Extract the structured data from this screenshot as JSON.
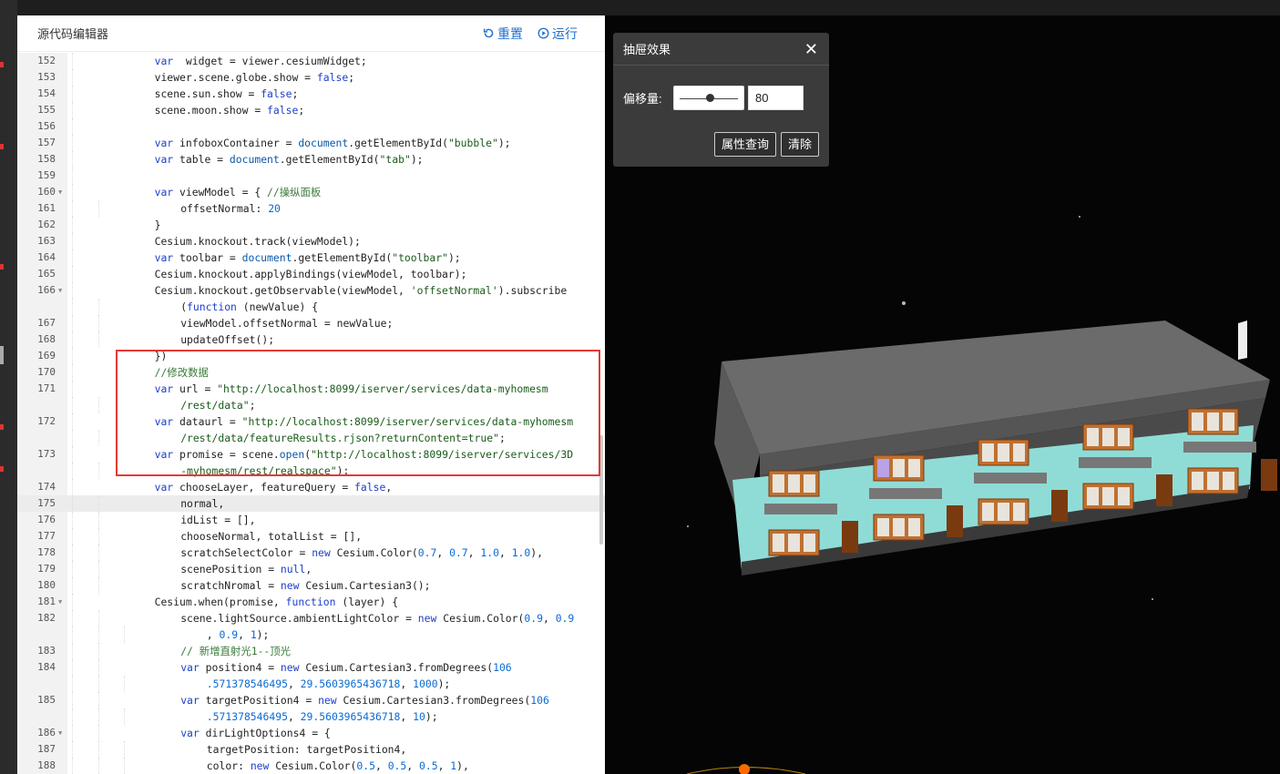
{
  "editor": {
    "title": "源代码编辑器",
    "reset_label": "重置",
    "run_label": "运行"
  },
  "code_lines": [
    {
      "n": "152",
      "i": 1,
      "t": [
        [
          "kw",
          "var"
        ],
        [
          "",
          "  widget = viewer.cesiumWidget;"
        ]
      ]
    },
    {
      "n": "153",
      "i": 1,
      "t": [
        [
          "",
          "viewer.scene.globe.show = "
        ],
        [
          "kw",
          "false"
        ],
        [
          "",
          ";"
        ]
      ]
    },
    {
      "n": "154",
      "i": 1,
      "t": [
        [
          "",
          "scene.sun.show = "
        ],
        [
          "kw",
          "false"
        ],
        [
          "",
          ";"
        ]
      ]
    },
    {
      "n": "155",
      "i": 1,
      "t": [
        [
          "",
          "scene.moon.show = "
        ],
        [
          "kw",
          "false"
        ],
        [
          "",
          ";"
        ]
      ]
    },
    {
      "n": "156",
      "i": 1,
      "t": []
    },
    {
      "n": "157",
      "i": 1,
      "t": [
        [
          "kw",
          "var"
        ],
        [
          "",
          " infoboxContainer = "
        ],
        [
          "prop",
          "document"
        ],
        [
          "",
          ".getElementById("
        ],
        [
          "str2",
          "\"bubble\""
        ],
        [
          "",
          ");"
        ]
      ]
    },
    {
      "n": "158",
      "i": 1,
      "t": [
        [
          "kw",
          "var"
        ],
        [
          "",
          " table = "
        ],
        [
          "prop",
          "document"
        ],
        [
          "",
          ".getElementById("
        ],
        [
          "str2",
          "\"tab\""
        ],
        [
          "",
          ");"
        ]
      ]
    },
    {
      "n": "159",
      "i": 1,
      "t": []
    },
    {
      "n": "160",
      "i": 1,
      "f": true,
      "t": [
        [
          "kw",
          "var"
        ],
        [
          "",
          " viewModel = { "
        ],
        [
          "cm",
          "//操纵面板"
        ]
      ]
    },
    {
      "n": "161",
      "i": 2,
      "t": [
        [
          "",
          "offsetNormal: "
        ],
        [
          "num",
          "20"
        ]
      ]
    },
    {
      "n": "162",
      "i": 1,
      "t": [
        [
          "",
          "}"
        ]
      ]
    },
    {
      "n": "163",
      "i": 1,
      "t": [
        [
          "",
          "Cesium.knockout.track(viewModel);"
        ]
      ]
    },
    {
      "n": "164",
      "i": 1,
      "t": [
        [
          "kw",
          "var"
        ],
        [
          "",
          " toolbar = "
        ],
        [
          "prop",
          "document"
        ],
        [
          "",
          ".getElementById("
        ],
        [
          "str2",
          "\"toolbar\""
        ],
        [
          "",
          ");"
        ]
      ]
    },
    {
      "n": "165",
      "i": 1,
      "t": [
        [
          "",
          "Cesium.knockout.applyBindings(viewModel, toolbar);"
        ]
      ]
    },
    {
      "n": "166",
      "i": 1,
      "f": true,
      "t": [
        [
          "",
          "Cesium.knockout.getObservable(viewModel, "
        ],
        [
          "str2",
          "'offsetNormal'"
        ],
        [
          "",
          ").subscribe"
        ]
      ]
    },
    {
      "n": "",
      "i": 2,
      "t": [
        [
          "",
          "("
        ],
        [
          "kw",
          "function"
        ],
        [
          "",
          " (newValue) {"
        ]
      ]
    },
    {
      "n": "167",
      "i": 2,
      "t": [
        [
          "",
          "viewModel.offsetNormal = newValue;"
        ]
      ]
    },
    {
      "n": "168",
      "i": 2,
      "t": [
        [
          "",
          "updateOffset();"
        ]
      ]
    },
    {
      "n": "169",
      "i": 1,
      "t": [
        [
          "",
          "})"
        ]
      ]
    },
    {
      "n": "170",
      "i": 1,
      "t": [
        [
          "cm",
          "//修改数据"
        ]
      ]
    },
    {
      "n": "171",
      "i": 1,
      "t": [
        [
          "kw",
          "var"
        ],
        [
          "",
          " url = "
        ],
        [
          "str2",
          "\"http://localhost:8099/iserver/services/data-myhomesm"
        ]
      ]
    },
    {
      "n": "",
      "i": 2,
      "t": [
        [
          "str2",
          "/rest/data\""
        ],
        [
          "",
          ";"
        ]
      ]
    },
    {
      "n": "172",
      "i": 1,
      "t": [
        [
          "kw",
          "var"
        ],
        [
          "",
          " dataurl = "
        ],
        [
          "str2",
          "\"http://localhost:8099/iserver/services/data-myhomesm"
        ]
      ]
    },
    {
      "n": "",
      "i": 2,
      "t": [
        [
          "str2",
          "/rest/data/featureResults.rjson?returnContent=true\""
        ],
        [
          "",
          ";"
        ]
      ]
    },
    {
      "n": "173",
      "i": 1,
      "t": [
        [
          "kw",
          "var"
        ],
        [
          "",
          " promise = scene."
        ],
        [
          "prop",
          "open"
        ],
        [
          "",
          "("
        ],
        [
          "str2",
          "\"http://localhost:8099/iserver/services/3D"
        ]
      ]
    },
    {
      "n": "",
      "i": 2,
      "t": [
        [
          "str2",
          "-myhomesm/rest/realspace\""
        ],
        [
          "",
          ");"
        ]
      ]
    },
    {
      "n": "174",
      "i": 1,
      "t": [
        [
          "kw",
          "var"
        ],
        [
          "",
          " chooseLayer, featureQuery = "
        ],
        [
          "kw",
          "false"
        ],
        [
          "",
          ","
        ]
      ]
    },
    {
      "n": "175",
      "i": 2,
      "a": true,
      "t": [
        [
          "",
          "normal,"
        ]
      ]
    },
    {
      "n": "176",
      "i": 2,
      "t": [
        [
          "",
          "idList = [],"
        ]
      ]
    },
    {
      "n": "177",
      "i": 2,
      "t": [
        [
          "",
          "chooseNormal, totalList = [],"
        ]
      ]
    },
    {
      "n": "178",
      "i": 2,
      "t": [
        [
          "",
          "scratchSelectColor = "
        ],
        [
          "kw",
          "new"
        ],
        [
          "",
          " Cesium.Color("
        ],
        [
          "num",
          "0.7"
        ],
        [
          "",
          ", "
        ],
        [
          "num",
          "0.7"
        ],
        [
          "",
          ", "
        ],
        [
          "num",
          "1.0"
        ],
        [
          "",
          ", "
        ],
        [
          "num",
          "1.0"
        ],
        [
          "",
          "),"
        ]
      ]
    },
    {
      "n": "179",
      "i": 2,
      "t": [
        [
          "",
          "scenePosition = "
        ],
        [
          "kw",
          "null"
        ],
        [
          "",
          ","
        ]
      ]
    },
    {
      "n": "180",
      "i": 2,
      "t": [
        [
          "",
          "scratchNromal = "
        ],
        [
          "kw",
          "new"
        ],
        [
          "",
          " Cesium.Cartesian3();"
        ]
      ]
    },
    {
      "n": "181",
      "i": 1,
      "f": true,
      "t": [
        [
          "",
          "Cesium.when(promise, "
        ],
        [
          "kw",
          "function"
        ],
        [
          "",
          " (layer) {"
        ]
      ]
    },
    {
      "n": "182",
      "i": 2,
      "t": [
        [
          "",
          "scene.lightSource.ambientLightColor = "
        ],
        [
          "kw",
          "new"
        ],
        [
          "",
          " Cesium.Color("
        ],
        [
          "num",
          "0.9"
        ],
        [
          "",
          ", "
        ],
        [
          "num",
          "0.9"
        ]
      ]
    },
    {
      "n": "",
      "i": 3,
      "t": [
        [
          "",
          ", "
        ],
        [
          "num",
          "0.9"
        ],
        [
          "",
          ", "
        ],
        [
          "num",
          "1"
        ],
        [
          "",
          ");"
        ]
      ]
    },
    {
      "n": "183",
      "i": 2,
      "t": [
        [
          "cm",
          "// 新增直射光1--顶光"
        ]
      ]
    },
    {
      "n": "184",
      "i": 2,
      "t": [
        [
          "kw",
          "var"
        ],
        [
          "",
          " position4 = "
        ],
        [
          "kw",
          "new"
        ],
        [
          "",
          " Cesium.Cartesian3.fromDegrees("
        ],
        [
          "num",
          "106"
        ]
      ]
    },
    {
      "n": "",
      "i": 3,
      "t": [
        [
          "num",
          ".571378546495"
        ],
        [
          "",
          ", "
        ],
        [
          "num",
          "29.5603965436718"
        ],
        [
          "",
          ", "
        ],
        [
          "num",
          "1000"
        ],
        [
          "",
          ");"
        ]
      ]
    },
    {
      "n": "185",
      "i": 2,
      "t": [
        [
          "kw",
          "var"
        ],
        [
          "",
          " targetPosition4 = "
        ],
        [
          "kw",
          "new"
        ],
        [
          "",
          " Cesium.Cartesian3.fromDegrees("
        ],
        [
          "num",
          "106"
        ]
      ]
    },
    {
      "n": "",
      "i": 3,
      "t": [
        [
          "num",
          ".571378546495"
        ],
        [
          "",
          ", "
        ],
        [
          "num",
          "29.5603965436718"
        ],
        [
          "",
          ", "
        ],
        [
          "num",
          "10"
        ],
        [
          "",
          ");"
        ]
      ]
    },
    {
      "n": "186",
      "i": 2,
      "f": true,
      "t": [
        [
          "kw",
          "var"
        ],
        [
          "",
          " dirLightOptions4 = {"
        ]
      ]
    },
    {
      "n": "187",
      "i": 3,
      "t": [
        [
          "",
          "targetPosition: targetPosition4,"
        ]
      ]
    },
    {
      "n": "188",
      "i": 3,
      "t": [
        [
          "",
          "color: "
        ],
        [
          "kw",
          "new"
        ],
        [
          "",
          " Cesium.Color("
        ],
        [
          "num",
          "0.5"
        ],
        [
          "",
          ", "
        ],
        [
          "num",
          "0.5"
        ],
        [
          "",
          ", "
        ],
        [
          "num",
          "0.5"
        ],
        [
          "",
          ", "
        ],
        [
          "num",
          "1"
        ],
        [
          "",
          "),"
        ]
      ]
    }
  ],
  "panel": {
    "title": "抽屉效果",
    "close_glyph": "✕",
    "offset_label": "偏移量:",
    "offset_value": "80",
    "offset_fraction": 0.5,
    "query_button": "属性查询",
    "clear_button": "清除"
  },
  "icons": {
    "reset": "reset-icon",
    "run": "play-circle-icon"
  },
  "colors": {
    "accent": "#1f6fd1",
    "highlight_border": "#e53935",
    "keyword": "#1e3fc8",
    "string": "#1a5a1a",
    "comment": "#3a7a3a"
  }
}
